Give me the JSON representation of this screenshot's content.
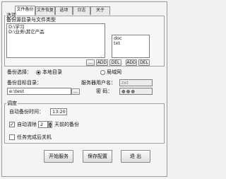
{
  "tabs": [
    {
      "label": "文件备份",
      "active": true
    },
    {
      "label": "文件恢复",
      "active": false
    },
    {
      "label": "选项",
      "active": false
    },
    {
      "label": "日志",
      "active": false
    },
    {
      "label": "关于",
      "active": false
    }
  ],
  "source_group": {
    "title": "选项",
    "subtitle": "备份源目录与文件类型",
    "folders": [
      "D:\\学习",
      "D:\\业务\\其它产品"
    ],
    "folder_buttons": {
      "browse": "...",
      "add": "ADD",
      "del": "DEL"
    },
    "types": [
      "doc",
      "txt"
    ],
    "type_buttons": {
      "add": "ADD",
      "del": "DEL"
    }
  },
  "backup_target": {
    "select_label": "备份选择：",
    "options": [
      {
        "label": "本地目录",
        "checked": true
      },
      {
        "label": "局域网",
        "checked": false
      }
    ],
    "target_dir_label": "备份目标目录：",
    "target_dir_value": "e:\\test",
    "browse_label": "...",
    "server_user_label": "服务器用户名：",
    "server_user_value": "zxt",
    "password_label": "密  码：",
    "password_value": "●●●"
  },
  "schedule": {
    "title": "调度",
    "auto_time_label": "自动备份时间：",
    "auto_time_value": "13:20",
    "auto_clear_checked": true,
    "auto_clear_label": "自动清除",
    "days_value": "2",
    "days_suffix": "天前的备份",
    "shutdown_checked": false,
    "shutdown_label": "任务完成后关机"
  },
  "actions": {
    "start": "开始服务",
    "save": "保存配置",
    "exit": "退  出"
  }
}
